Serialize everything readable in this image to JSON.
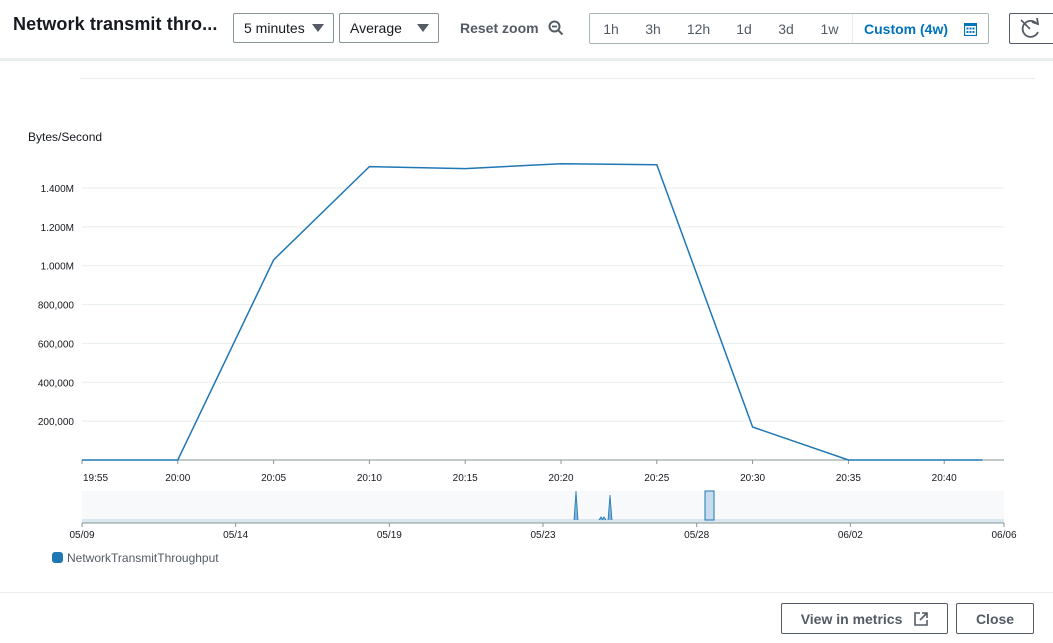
{
  "header": {
    "title": "Network transmit thro...",
    "period": "5 minutes",
    "statistic": "Average",
    "reset_zoom": "Reset zoom",
    "ranges": [
      "1h",
      "3h",
      "12h",
      "1d",
      "3d",
      "1w"
    ],
    "custom_range": "Custom (4w)"
  },
  "icons": {
    "zoom": "zoom-out-icon",
    "calendar": "calendar-icon",
    "refresh_close": "refresh-icon"
  },
  "chart_data": {
    "type": "line",
    "title": "",
    "ylabel": "Bytes/Second",
    "xlabel": "",
    "ylim": [
      0,
      1400000
    ],
    "y_ticks": [
      200000,
      400000,
      600000,
      800000,
      1000000,
      1200000,
      1400000
    ],
    "y_tick_labels": [
      "200,000",
      "400,000",
      "600,000",
      "800,000",
      "1.000M",
      "1.200M",
      "1.400M"
    ],
    "x_tick_labels": [
      "19:55",
      "20:00",
      "20:05",
      "20:10",
      "20:15",
      "20:20",
      "20:25",
      "20:30",
      "20:35",
      "20:40"
    ],
    "series": [
      {
        "name": "NetworkTransmitThroughput",
        "color": "#1f77b4",
        "x": [
          "19:55",
          "20:00",
          "20:05",
          "20:10",
          "20:15",
          "20:20",
          "20:25",
          "20:30",
          "20:35",
          "20:40",
          "20:42"
        ],
        "values": [
          0,
          0,
          1030000,
          1510000,
          1500000,
          1525000,
          1520000,
          170000,
          0,
          0,
          0
        ]
      }
    ],
    "overview_tick_labels": [
      "05/09",
      "05/14",
      "05/19",
      "05/23",
      "05/28",
      "06/02",
      "06/06"
    ],
    "legend_position": "bottom-left",
    "grid": true
  },
  "footer": {
    "view_metrics": "View in metrics",
    "close": "Close"
  },
  "colors": {
    "accent": "#0073bb",
    "series": "#1f77b4",
    "text": "#16191f",
    "muted": "#545b64"
  }
}
